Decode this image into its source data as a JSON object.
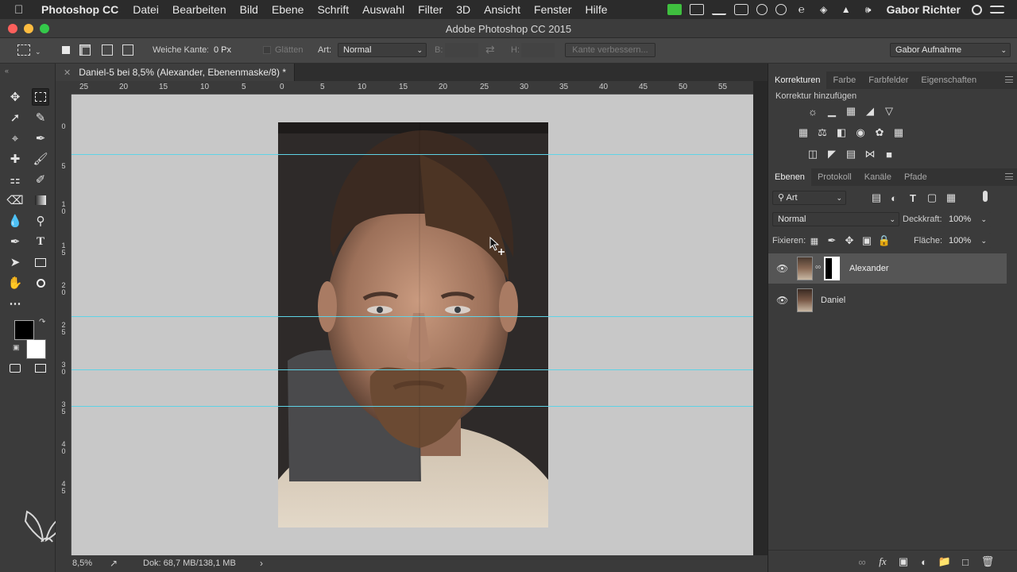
{
  "menubar": {
    "app_name": "Photoshop CC",
    "items": [
      "Datei",
      "Bearbeiten",
      "Bild",
      "Ebene",
      "Schrift",
      "Auswahl",
      "Filter",
      "3D",
      "Ansicht",
      "Fenster",
      "Hilfe"
    ],
    "user": "Gabor Richter"
  },
  "window": {
    "title": "Adobe Photoshop CC 2015"
  },
  "options": {
    "feather_label": "Weiche Kante:",
    "feather_value": "0 Px",
    "antialias_label": "Glätten",
    "style_label": "Art:",
    "style_value": "Normal",
    "width_label": "B:",
    "height_label": "H:",
    "refine_edge_label": "Kante verbessern...",
    "workspace": "Gabor Aufnahme"
  },
  "document": {
    "tab_title": "Daniel-5 bei 8,5% (Alexander, Ebenenmaske/8) *",
    "ruler_h": [
      "25",
      "20",
      "15",
      "10",
      "5",
      "0",
      "5",
      "10",
      "15",
      "20",
      "25",
      "30",
      "35",
      "40",
      "45",
      "50",
      "55"
    ],
    "ruler_v": [
      "0",
      "5",
      "1\n0",
      "1\n5",
      "2\n0",
      "2\n5",
      "3\n0",
      "3\n5",
      "4\n0",
      "4\n5"
    ],
    "zoom": "8,5%",
    "doc_size": "Dok: 68,7 MB/138,1 MB"
  },
  "adjustments_panel": {
    "tabs": [
      "Korrekturen",
      "Farbe",
      "Farbfelder",
      "Eigenschaften"
    ],
    "active_tab": 0,
    "add_label": "Korrektur hinzufügen"
  },
  "layers_panel": {
    "tabs": [
      "Ebenen",
      "Protokoll",
      "Kanäle",
      "Pfade"
    ],
    "active_tab": 0,
    "filter_label": "Art",
    "blend_mode": "Normal",
    "opacity_label": "Deckkraft:",
    "opacity_value": "100%",
    "lock_label": "Fixieren:",
    "fill_label": "Fläche:",
    "fill_value": "100%",
    "layers": [
      {
        "name": "Alexander",
        "visible": true,
        "selected": true,
        "has_mask": true
      },
      {
        "name": "Daniel",
        "visible": true,
        "selected": false,
        "has_mask": false
      }
    ]
  },
  "colors": {
    "foreground": "#000000",
    "background": "#ffffff",
    "guide": "#5fd3e6",
    "canvas_bg": "#c8c8c8",
    "tray_green": "#3fbf3f",
    "close_light": "#fc605c",
    "min_light": "#fdbc40",
    "max_light": "#34c84a"
  }
}
